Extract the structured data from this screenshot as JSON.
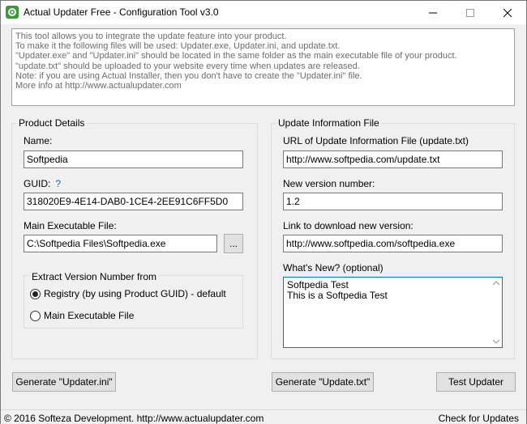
{
  "window": {
    "title": "Actual Updater Free - Configuration Tool v3.0"
  },
  "info": {
    "lines": [
      "This tool allows you to integrate the update feature into your product.",
      "To make it the following files will be used: Updater.exe, Updater.ini, and update.txt.",
      "\"Updater.exe\" and \"Updater.ini\" should be located in the same folder as the main executable file of your product.",
      "\"update.txt\" should be uploaded to your website every time when updates are released.",
      "Note: if you are using Actual Installer, then you don't have to create the \"Updater.ini\" file.",
      "More info at http://www.actualupdater.com"
    ]
  },
  "product": {
    "group_title": "Product Details",
    "name_label": "Name:",
    "name_value": "Softpedia",
    "guid_label": "GUID:",
    "guid_help": "?",
    "guid_value": "318020E9-4E14-DAB0-1CE4-2EE91C6FF5D0",
    "exe_label": "Main Executable File:",
    "exe_value": "C:\\Softpedia Files\\Softpedia.exe",
    "browse_label": "...",
    "extract_title": "Extract Version Number from",
    "radio_registry": "Registry (by using Product GUID) - default",
    "radio_exe": "Main Executable File",
    "generate_ini": "Generate \"Updater.ini\""
  },
  "update": {
    "group_title": "Update Information File",
    "url_label": "URL of Update Information File (update.txt)",
    "url_value": "http://www.softpedia.com/update.txt",
    "version_label": "New version number:",
    "version_value": "1.2",
    "download_label": "Link to download new version:",
    "download_value": "http://www.softpedia.com/softpedia.exe",
    "whatsnew_label": "What's New? (optional)",
    "whatsnew_lines": [
      "Softpedia Test",
      "This is a Softpedia Test"
    ],
    "generate_txt": "Generate \"Update.txt\"",
    "test_updater": "Test Updater"
  },
  "status": {
    "left": "© 2016 Softeza Development.  http://www.actualupdater.com",
    "right": "Check for Updates"
  }
}
